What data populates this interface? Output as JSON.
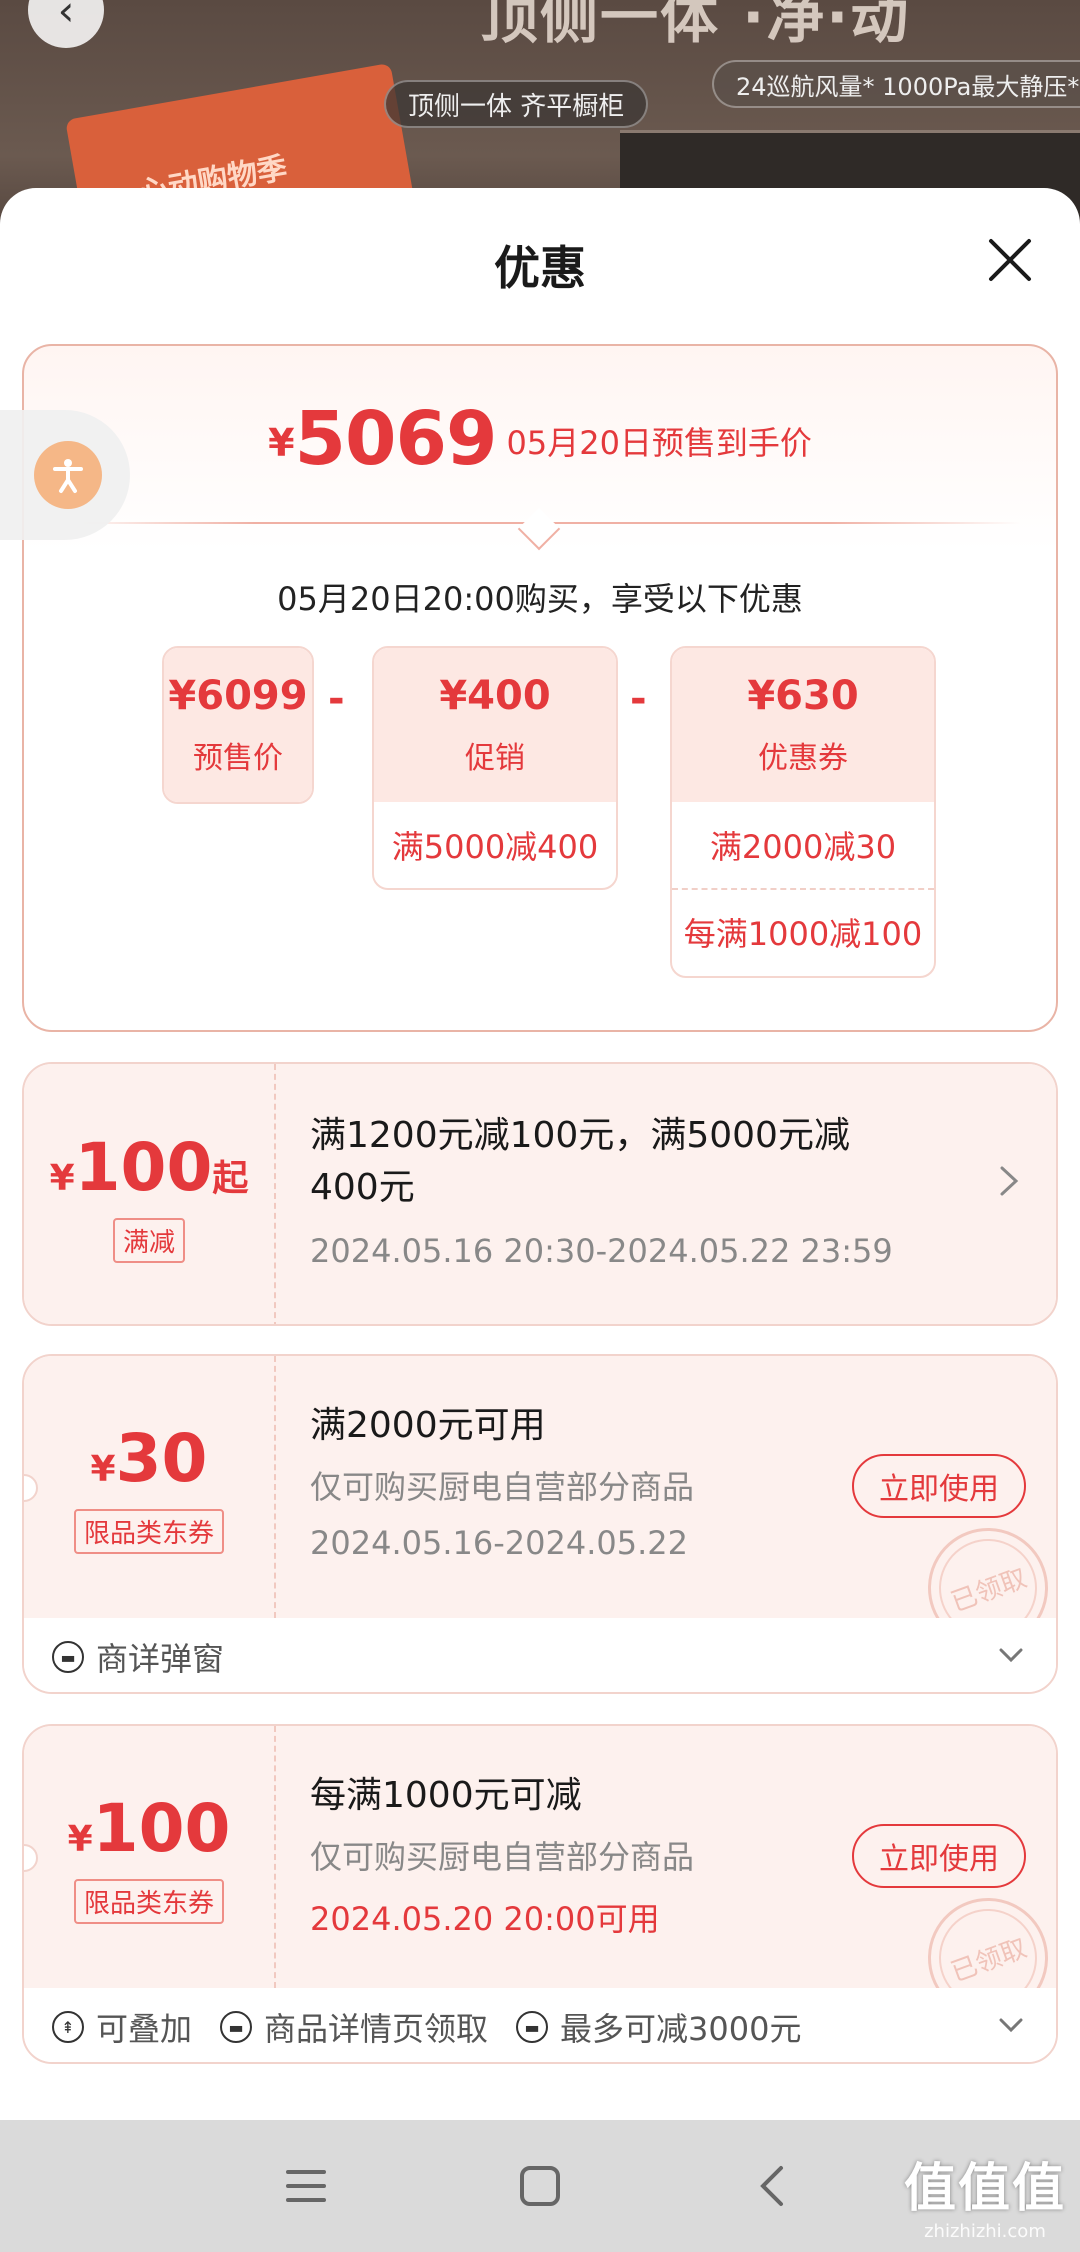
{
  "background": {
    "headline": "顶侧一体 ·净·动",
    "pill1": "顶侧一体 齐平橱柜",
    "pill2": "24巡航风量* 1000Pa最大静压*",
    "badge": "心动购物季"
  },
  "sheet": {
    "title": "优惠"
  },
  "summary": {
    "currency": "¥",
    "price": "5069",
    "price_desc": "05月20日预售到手价",
    "buy_note": "05月20日20:00购买，享受以下优惠",
    "breakdown": [
      {
        "value": "¥6099",
        "label": "预售价",
        "rows": []
      },
      {
        "value": "¥400",
        "label": "促销",
        "rows": [
          "满5000减400"
        ]
      },
      {
        "value": "¥630",
        "label": "优惠券",
        "rows": [
          "满2000减30",
          "每满1000减100"
        ]
      }
    ],
    "minus": "-"
  },
  "coupons": [
    {
      "currency": "¥",
      "amount": "100",
      "suffix": "起",
      "tag": "满减",
      "title": "满1200元减100元，满5000元减400元",
      "sub1": "2024.05.16 20:30-2024.05.22 23:59"
    },
    {
      "currency": "¥",
      "amount": "30",
      "tag": "限品类东券",
      "title": "满2000元可用",
      "sub1": "仅可购买厨电自营部分商品",
      "sub2": "2024.05.16-2024.05.22",
      "button": "立即使用",
      "stamp": "已领取",
      "footer": [
        "商详弹窗"
      ]
    },
    {
      "currency": "¥",
      "amount": "100",
      "tag": "限品类东券",
      "title": "每满1000元可减",
      "sub1": "仅可购买厨电自营部分商品",
      "sub2": "2024.05.20 20:00可用",
      "button": "立即使用",
      "stamp": "已领取",
      "footer": [
        "可叠加",
        "商品详情页领取",
        "最多可减3000元"
      ]
    }
  ],
  "watermark": {
    "big": "值值值",
    "small": "zhizhizhi.com"
  },
  "colors": {
    "accent": "#e4393c",
    "pink_bg": "#fdf1ee"
  }
}
